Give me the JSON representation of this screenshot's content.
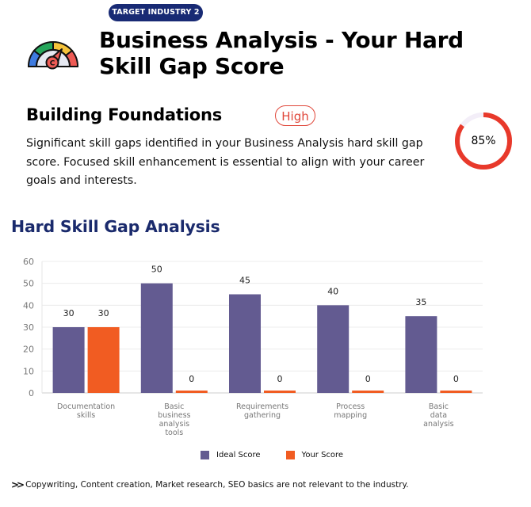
{
  "header": {
    "badge": "TARGET INDUSTRY 2",
    "title": "Business Analysis - Your Hard Skill Gap Score",
    "icon": "speedometer-gauge-icon"
  },
  "summary": {
    "level_title": "Building Foundations",
    "gap_level": "High",
    "gap_level_color": "#e0473a",
    "description": "Significant skill gaps identified in your Business Analysis hard skill gap score. Focused skill enhancement is essential to align with your career goals and interests.",
    "score_percent": 85,
    "score_label": "85%",
    "ring_color": "#e8392b",
    "ring_track_color": "#f3eef8"
  },
  "section": {
    "title": "Hard Skill Gap Analysis"
  },
  "chart_data": {
    "type": "bar",
    "title": "Hard Skill Gap Analysis",
    "xlabel": "",
    "ylabel": "",
    "ylim": [
      0,
      60
    ],
    "yticks": [
      0,
      10,
      20,
      30,
      40,
      50,
      60
    ],
    "grid": true,
    "legend_position": "bottom",
    "categories": [
      [
        "Documentation",
        "skills"
      ],
      [
        "Basic",
        "business",
        "analysis",
        "tools"
      ],
      [
        "Requirements",
        "gathering"
      ],
      [
        "Process",
        "mapping"
      ],
      [
        "Basic",
        "data",
        "analysis"
      ]
    ],
    "series": [
      {
        "name": "Ideal Score",
        "color": "#635b91",
        "values": [
          30,
          50,
          45,
          40,
          35
        ]
      },
      {
        "name": "Your Score",
        "color": "#f15c22",
        "values": [
          30,
          0,
          0,
          0,
          0
        ]
      }
    ]
  },
  "legend": {
    "items": [
      {
        "label": "Ideal Score",
        "color": "#635b91"
      },
      {
        "label": "Your Score",
        "color": "#f15c22"
      }
    ]
  },
  "footnote": {
    "icon": "double-chevron-right-icon",
    "text": "Copywriting, Content creation, Market research, SEO basics are not relevant to the industry."
  }
}
